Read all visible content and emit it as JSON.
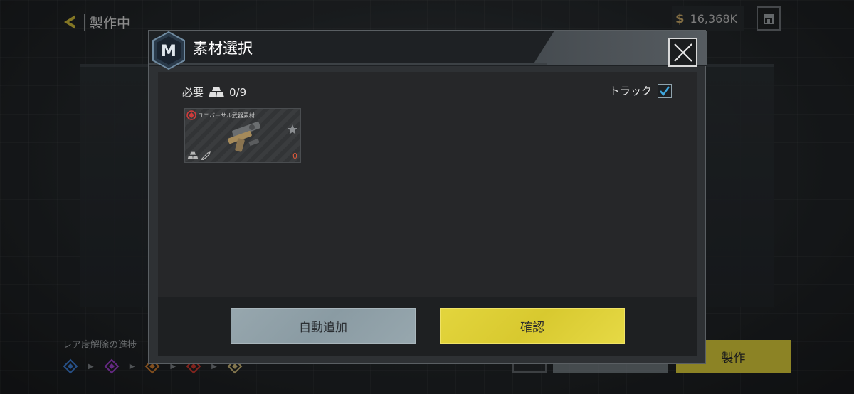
{
  "background": {
    "title": "製作中",
    "currency": {
      "amount": "16,368K",
      "icon": "dollar-icon",
      "symbol": "$"
    },
    "store_icon": "store-icon",
    "rarity_progress_label": "レア度解除の進捗",
    "craft_label": "製作"
  },
  "modal": {
    "title": "素材選択",
    "logo_letter": "M",
    "required_label": "必要",
    "required_count": "0/9",
    "track_label": "トラック",
    "track_checked": true,
    "item": {
      "name": "ユニバーサル武器素材",
      "count": "0"
    },
    "buttons": {
      "auto_add": "自動追加",
      "confirm": "確認"
    }
  },
  "colors": {
    "accent_yellow": "#d8c92f",
    "secondary_button": "#8a9ba3",
    "checkbox_check": "#3fa8e0",
    "count_red": "#e05a3b"
  }
}
